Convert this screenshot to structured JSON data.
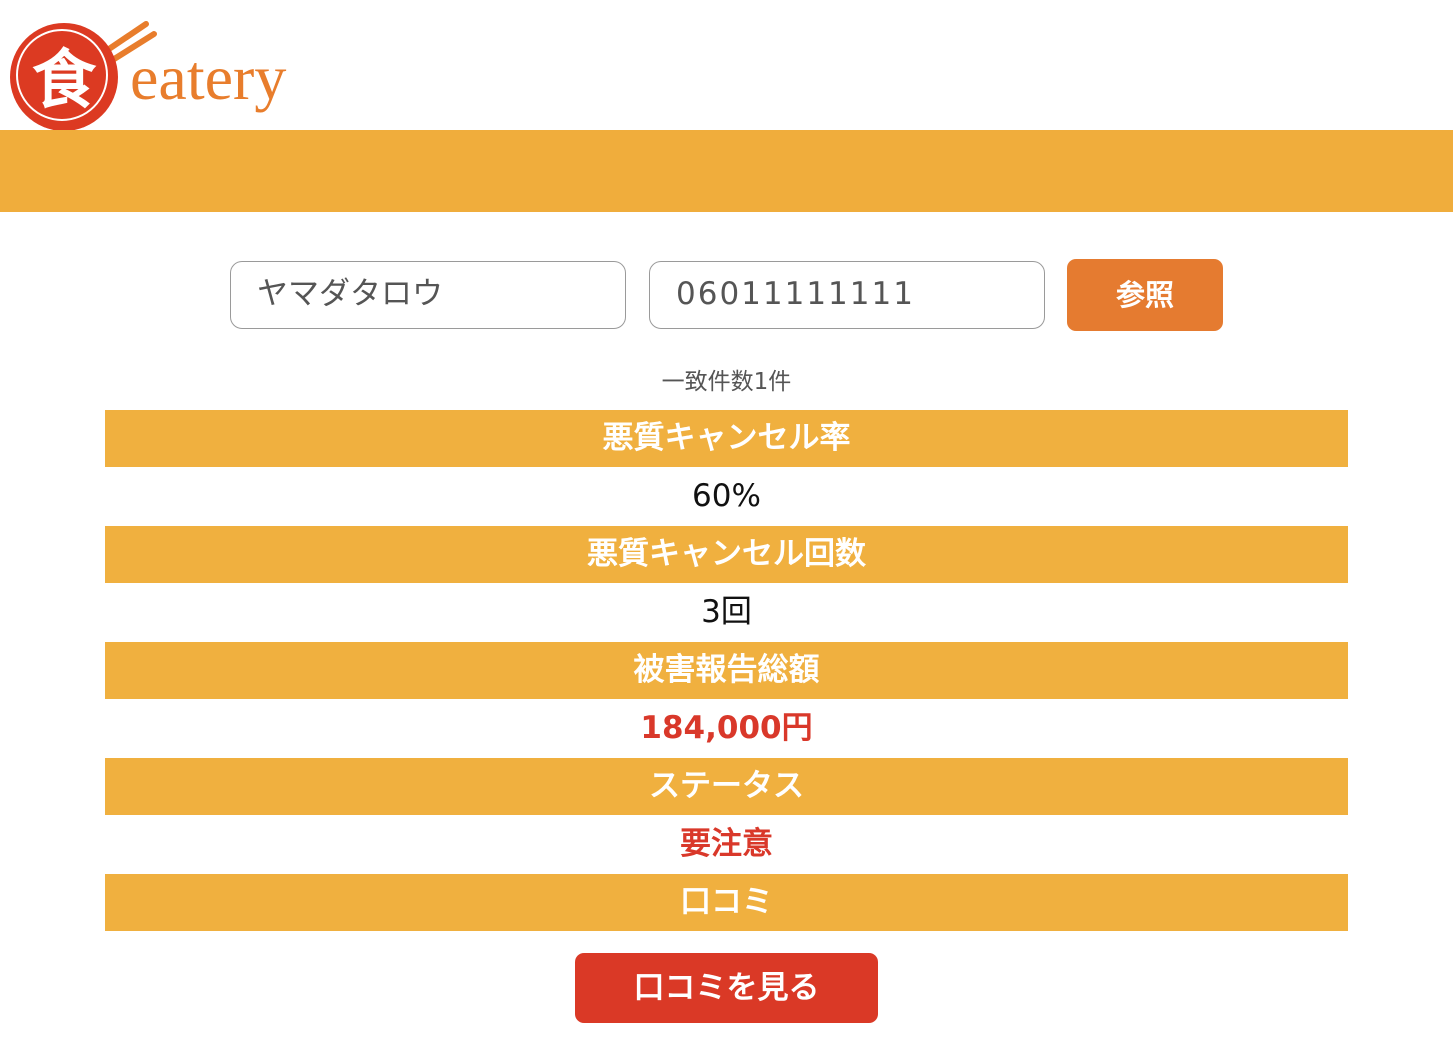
{
  "logo": {
    "kanji": "食",
    "wordmark": "eatery"
  },
  "colors": {
    "brand_orange": "#f0ad3c",
    "button_orange": "#e57b30",
    "alert_red": "#d9382a",
    "logo_red": "#dc3a22"
  },
  "search": {
    "name_value": "ヤマダタロウ",
    "phone_value": "06011111111",
    "submit_label": "参照"
  },
  "results": {
    "match_count": "一致件数1件",
    "rows": [
      {
        "label": "悪質キャンセル率",
        "value": "60%"
      },
      {
        "label": "悪質キャンセル回数",
        "value": "3回"
      },
      {
        "label": "被害報告総額",
        "value": "184,000円"
      },
      {
        "label": "ステータス",
        "value": "要注意"
      },
      {
        "label": "口コミ"
      }
    ]
  },
  "reviews_button_label": "口コミを見る"
}
